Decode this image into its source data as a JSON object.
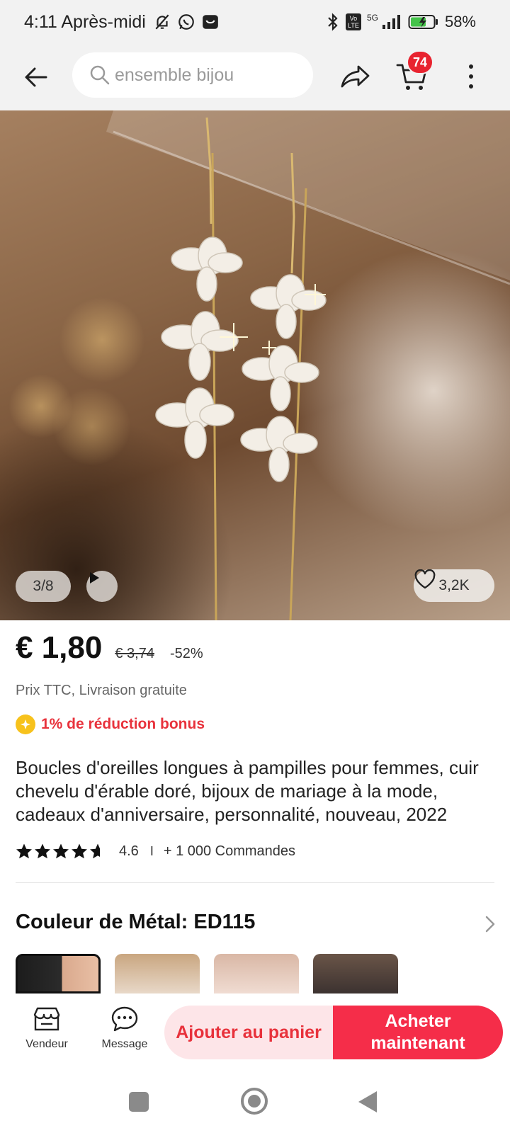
{
  "status_bar": {
    "time": "4:11 Après-midi",
    "network": "5G",
    "volte": "Vo LTE",
    "battery_percent": "58%",
    "icons": [
      "mute-bell-icon",
      "whatsapp-icon",
      "app-notification-icon",
      "bluetooth-icon",
      "signal-icon",
      "battery-charging-icon"
    ]
  },
  "header": {
    "search_text": "ensemble bijou",
    "cart_count": "74",
    "icons": [
      "back-arrow-icon",
      "search-icon",
      "share-icon",
      "cart-icon",
      "more-vertical-icon"
    ]
  },
  "gallery": {
    "counter": "3/8",
    "likes": "3,2K",
    "icons": [
      "play-icon",
      "heart-icon"
    ]
  },
  "price": {
    "current": "€ 1,80",
    "original": "€ 3,74",
    "discount": "-52%",
    "tax_note": "Prix TTC, Livraison gratuite",
    "bonus": "1% de réduction bonus"
  },
  "product": {
    "title": "Boucles d'oreilles longues à pampilles pour femmes, cuir chevelu d'érable doré, bijoux de mariage à la mode, cadeaux d'anniversaire, personnalité, nouveau, 2022",
    "rating": "4.6",
    "rating_stars": 4.6,
    "separator": "I",
    "orders": "+ 1 000 Commandes"
  },
  "variant": {
    "title": "Couleur de Métal: ED115",
    "selected_index": 0
  },
  "action_bar": {
    "vendor_label": "Vendeur",
    "message_label": "Message",
    "add_to_cart": "Ajouter au panier",
    "buy_now": "Acheter maintenant"
  },
  "colors": {
    "accent_red": "#f52d49",
    "badge_red": "#e8232f",
    "bonus_red": "#e8323c",
    "bonus_yellow": "#f7c21c",
    "cart_button_bg": "#fde5e8"
  }
}
